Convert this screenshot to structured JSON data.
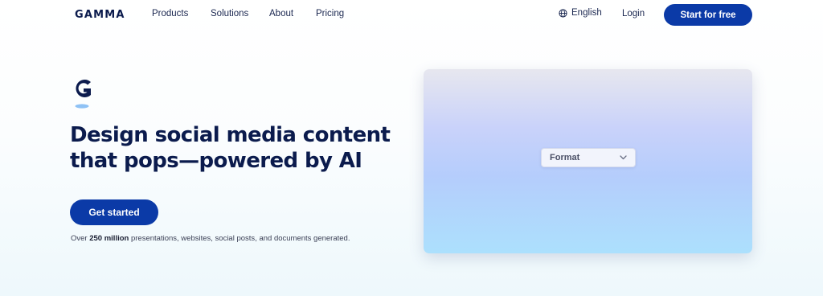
{
  "nav": {
    "logo": "GAMMA",
    "links": [
      "Products",
      "Solutions",
      "About",
      "Pricing"
    ],
    "language": "English",
    "login": "Login",
    "cta": "Start for free"
  },
  "hero": {
    "brand_icon": "gamma-g-icon",
    "headline_line1": "Design social media content",
    "headline_line2": "that pops—powered by AI",
    "button": "Get started",
    "stat_prefix": "Over ",
    "stat_value": "250 million",
    "stat_suffix": " presentations, websites, social posts, and documents generated."
  },
  "preview": {
    "format_label": "Format",
    "format_icon": "chevron-down-icon"
  },
  "colors": {
    "brand_dark": "#0b1b4d",
    "accent": "#0b3aa7"
  }
}
